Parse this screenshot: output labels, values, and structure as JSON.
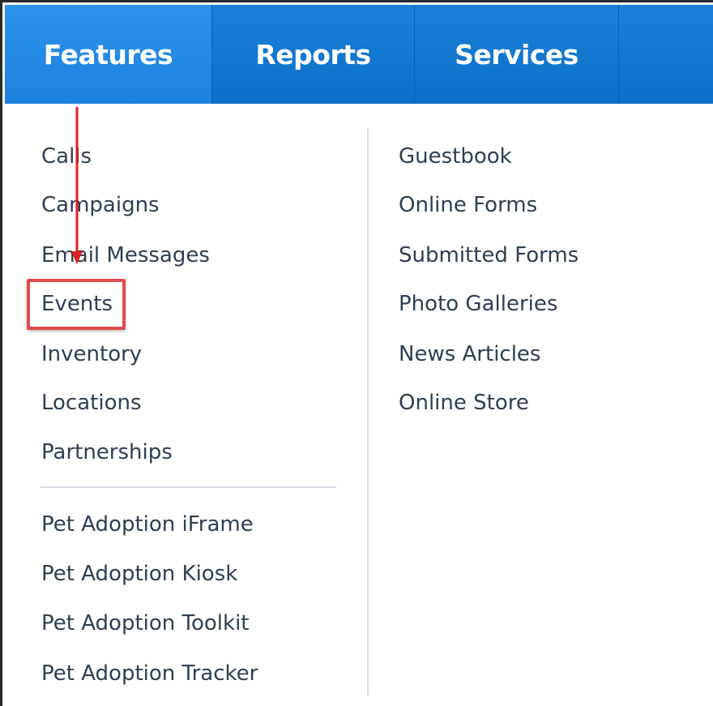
{
  "nav": {
    "tabs": [
      {
        "label": "Features"
      },
      {
        "label": "Reports"
      },
      {
        "label": "Services"
      }
    ],
    "active_tab": "Features"
  },
  "menu": {
    "left_group_1": [
      "Calls",
      "Campaigns",
      "Email Messages",
      "Events",
      "Inventory",
      "Locations",
      "Partnerships"
    ],
    "left_group_2": [
      "Pet Adoption iFrame",
      "Pet Adoption Kiosk",
      "Pet Adoption Toolkit",
      "Pet Adoption Tracker"
    ],
    "right": [
      "Guestbook",
      "Online Forms",
      "Submitted Forms",
      "Photo Galleries",
      "News Articles",
      "Online Store"
    ]
  },
  "annotations": {
    "highlighted_item": "Events",
    "highlight_color": "#e04b4b",
    "arrow_color": "#e02020"
  },
  "colors": {
    "nav_bg": "#1277d0",
    "nav_active_bg": "#2b93ea",
    "nav_text": "#ffffff",
    "menu_text": "#2e3f52",
    "divider": "#d6dde4"
  }
}
